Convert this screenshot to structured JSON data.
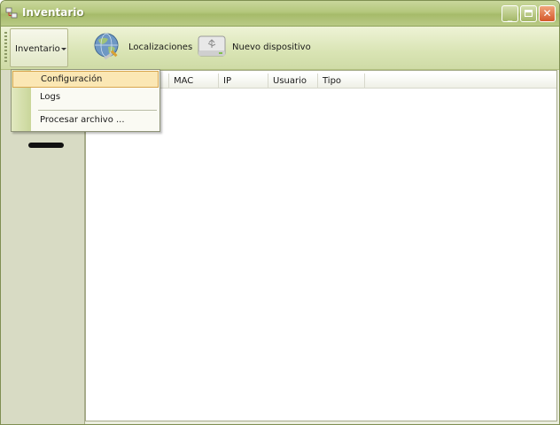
{
  "window": {
    "title": "Inventario",
    "controls": {
      "minimize": "_",
      "close": "✕"
    }
  },
  "toolbar": {
    "dropdown_label": "Inventario",
    "buttons": [
      {
        "label": "Localizaciones",
        "icon": "globe-icon"
      },
      {
        "label": "Nuevo dispositivo",
        "icon": "usb-drive-icon"
      }
    ]
  },
  "menu": {
    "items": [
      {
        "label": "Configuración",
        "selected": true
      },
      {
        "label": "Logs",
        "selected": false
      },
      {
        "label": "Procesar archivo ...",
        "selected": false
      }
    ]
  },
  "list": {
    "columns": [
      "MAC",
      "IP",
      "Usuario",
      "Tipo"
    ]
  },
  "colors": {
    "titlebar": "#b4c77c",
    "toolbar": "#d9e4b4",
    "sidebar": "#d8dbc4",
    "menu_highlight": "#fbe7b4"
  }
}
